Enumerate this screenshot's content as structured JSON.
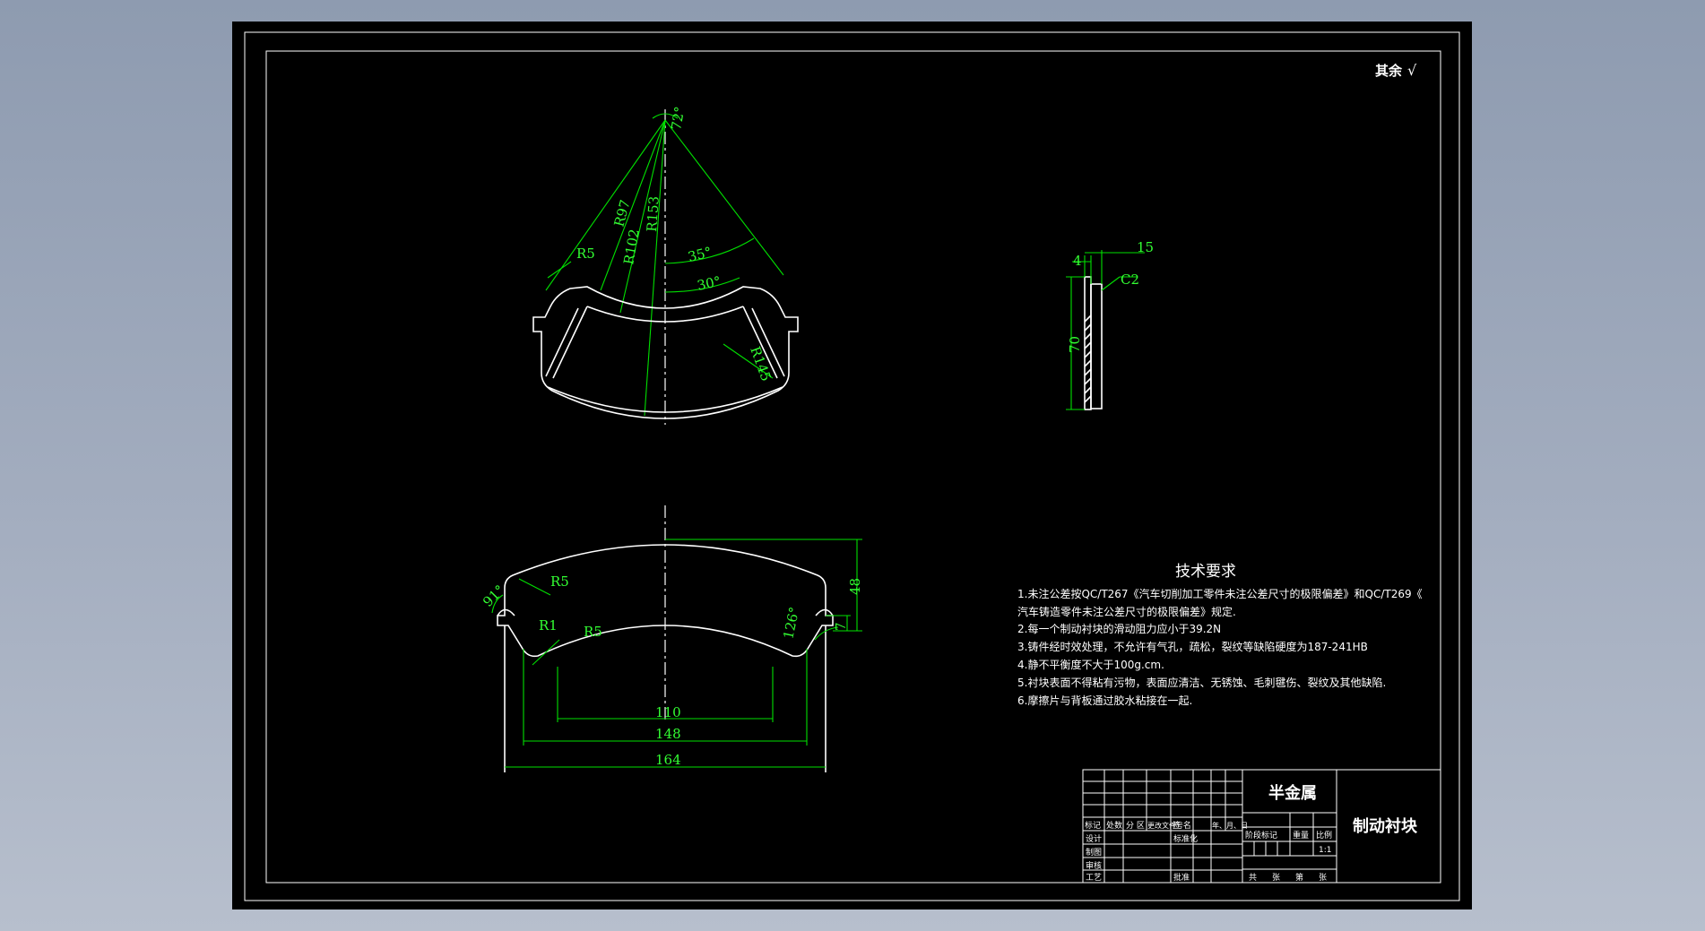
{
  "drawing": {
    "roughness_note": "其余",
    "roughness_symbol": "√",
    "top_view": {
      "angle_apex": "72°",
      "radius_97": "R97",
      "radius_102": "R102",
      "radius_153": "R153",
      "radius_5": "R5",
      "angle_35": "35°",
      "angle_30": "30°",
      "radius_145": "R145"
    },
    "front_view": {
      "angle_91": "91°",
      "radius_5_upper": "R5",
      "radius_1": "R1",
      "radius_5_lower": "R5",
      "angle_126": "126°",
      "dim_48": "48",
      "dim_7": "7",
      "dim_110": "110",
      "dim_148": "148",
      "dim_164": "164"
    },
    "side_view": {
      "dim_15": "15",
      "dim_4": "4",
      "chamfer": "C2",
      "dim_70": "70"
    }
  },
  "tech_requirements": {
    "title": "技术要求",
    "lines": [
      "1.未注公差按QC/T267《汽车切削加工零件未注公差尺寸的极限偏差》和QC/T269《",
      "汽车铸造零件未注公差尺寸的极限偏差》规定.",
      "2.每一个制动衬块的滑动阻力应小于39.2N",
      "3.铸件经时效处理，不允许有气孔，疏松，裂纹等缺陷硬度为187-241HB",
      "4.静不平衡度不大于100g.cm.",
      "5.衬块表面不得粘有污物，表面应清洁、无锈蚀、毛刺毽伤、裂纹及其他缺陷.",
      "6.摩擦片与背板通过胶水粘接在一起."
    ]
  },
  "title_block": {
    "material": "半金属",
    "part_name": "制动衬块",
    "row_headers": [
      "标记",
      "处数",
      "分 区",
      "更改文件号",
      "签 名",
      "年、月、日"
    ],
    "left_labels": [
      "设计",
      "制图",
      "审核",
      "工艺"
    ],
    "standardization": "标准化",
    "approval": "批准",
    "stage_headers": [
      "阶段标记",
      "重量",
      "比例"
    ],
    "scale": "1:1",
    "sheets": [
      "共",
      "张",
      "第",
      "张"
    ]
  }
}
